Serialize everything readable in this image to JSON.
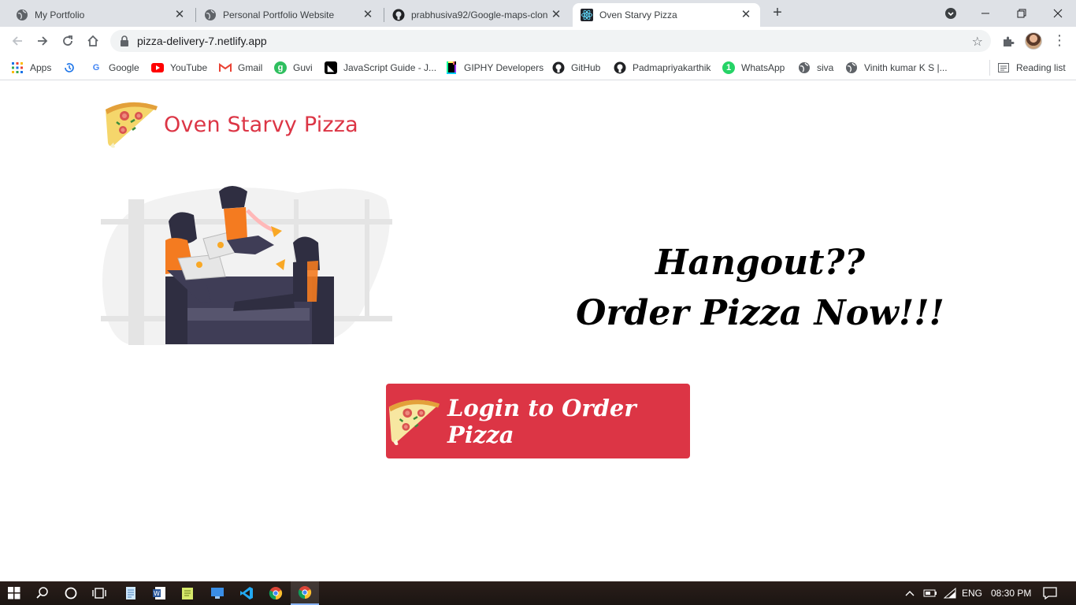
{
  "browser": {
    "tabs": [
      {
        "title": "My Portfolio",
        "favicon": "globe-icon",
        "active": false
      },
      {
        "title": "Personal Portfolio Website",
        "favicon": "globe-icon",
        "active": false
      },
      {
        "title": "prabhusiva92/Google-maps-clon",
        "favicon": "github-icon",
        "active": false
      },
      {
        "title": "Oven Starvy Pizza",
        "favicon": "react-icon",
        "active": true
      }
    ],
    "address": {
      "url": "pizza-delivery-7.netlify.app"
    },
    "bookmarks": [
      {
        "label": "Apps",
        "icon": "apps-grid-icon"
      },
      {
        "label": "",
        "icon": "history-icon"
      },
      {
        "label": "Google",
        "icon": "google-icon"
      },
      {
        "label": "YouTube",
        "icon": "youtube-icon"
      },
      {
        "label": "Gmail",
        "icon": "gmail-icon"
      },
      {
        "label": "Guvi",
        "icon": "guvi-icon"
      },
      {
        "label": "JavaScript Guide - J...",
        "icon": "mdn-icon"
      },
      {
        "label": "GIPHY Developers",
        "icon": "giphy-icon"
      },
      {
        "label": "GitHub",
        "icon": "github-icon"
      },
      {
        "label": "Padmapriyakarthik",
        "icon": "github-icon"
      },
      {
        "label": "WhatsApp",
        "icon": "whatsapp-icon"
      },
      {
        "label": "siva",
        "icon": "globe-icon"
      },
      {
        "label": "Vinith kumar K S |...",
        "icon": "globe-icon"
      }
    ],
    "reading_list": "Reading list"
  },
  "page": {
    "brand": "Oven Starvy Pizza",
    "headline_line1": "Hangout??",
    "headline_line2": "Order Pizza Now!!!",
    "login_button": "Login to Order Pizza",
    "accent_color": "#dc3545"
  },
  "taskbar": {
    "language": "ENG",
    "time": "08:30 PM"
  }
}
